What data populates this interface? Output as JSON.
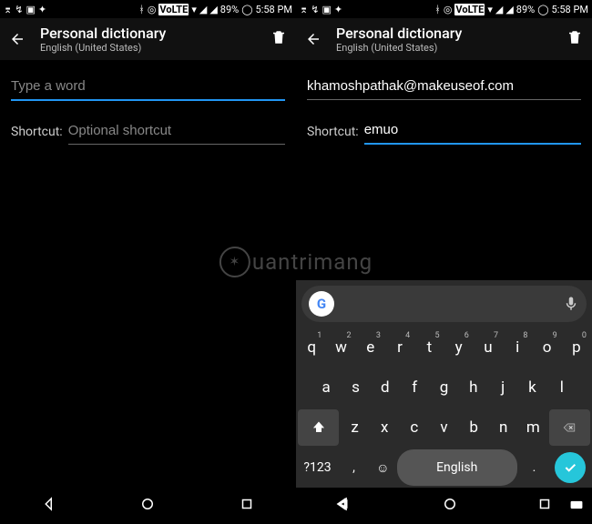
{
  "status": {
    "battery": "89%",
    "time": "5:58 PM"
  },
  "appbar": {
    "title": "Personal dictionary",
    "subtitle": "English (United States)"
  },
  "left": {
    "word_value": "",
    "word_placeholder": "Type a word",
    "shortcut_label": "Shortcut:",
    "shortcut_value": "",
    "shortcut_placeholder": "Optional shortcut"
  },
  "right": {
    "word_value": "khamoshpathak@makeuseof.com",
    "word_placeholder": "Type a word",
    "shortcut_label": "Shortcut:",
    "shortcut_value": "emuo",
    "shortcut_placeholder": "Optional shortcut"
  },
  "keyboard": {
    "row1": [
      "q",
      "w",
      "e",
      "r",
      "t",
      "y",
      "u",
      "i",
      "o",
      "p"
    ],
    "nums": [
      "1",
      "2",
      "3",
      "4",
      "5",
      "6",
      "7",
      "8",
      "9",
      "0"
    ],
    "row2": [
      "a",
      "s",
      "d",
      "f",
      "g",
      "h",
      "j",
      "k",
      "l"
    ],
    "row3": [
      "z",
      "x",
      "c",
      "v",
      "b",
      "n",
      "m"
    ],
    "symbols": "?123",
    "space": "English",
    "comma": ",",
    "period": "."
  },
  "watermark": "uantrimang"
}
